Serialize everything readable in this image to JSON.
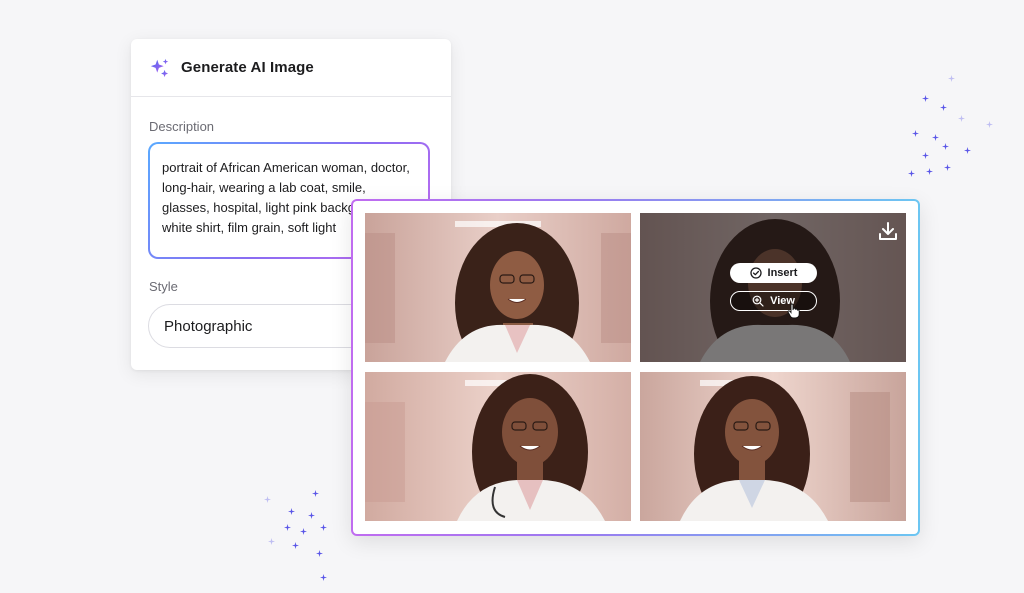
{
  "panel": {
    "title": "Generate AI Image",
    "description_label": "Description",
    "description_value": "portrait of African American woman, doctor, long-hair, wearing a lab coat, smile, glasses, hospital, light pink background, white shirt, film grain, soft light",
    "style_label": "Style",
    "style_value": "Photographic"
  },
  "results": {
    "insert_label": "Insert",
    "view_label": "View"
  },
  "colors": {
    "accent_gradient_start": "#5aa9ff",
    "accent_gradient_mid": "#8a6cf2",
    "accent_gradient_end": "#c86cf0",
    "sparkle": "#5b57e8"
  },
  "icons": {
    "header": "sparkle-ai-icon",
    "insert": "check-circle-icon",
    "view": "zoom-in-icon",
    "download": "download-icon",
    "cursor": "hand-pointer-icon"
  }
}
